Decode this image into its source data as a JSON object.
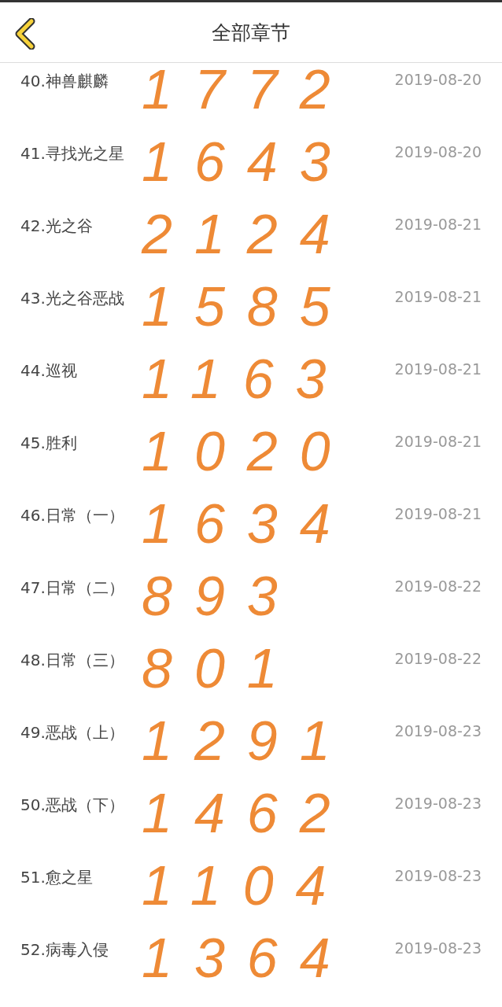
{
  "header": {
    "title": "全部章节"
  },
  "chapters": [
    {
      "title": "40.神兽麒麟",
      "date": "2019-08-20",
      "note": "1772"
    },
    {
      "title": "41.寻找光之星",
      "date": "2019-08-20",
      "note": "1643"
    },
    {
      "title": "42.光之谷",
      "date": "2019-08-21",
      "note": "2124"
    },
    {
      "title": "43.光之谷恶战",
      "date": "2019-08-21",
      "note": "1585"
    },
    {
      "title": "44.巡视",
      "date": "2019-08-21",
      "note": "1163"
    },
    {
      "title": "45.胜利",
      "date": "2019-08-21",
      "note": "1020"
    },
    {
      "title": "46.日常（一）",
      "date": "2019-08-21",
      "note": "1634"
    },
    {
      "title": "47.日常（二）",
      "date": "2019-08-22",
      "note": "893"
    },
    {
      "title": "48.日常（三）",
      "date": "2019-08-22",
      "note": "801"
    },
    {
      "title": "49.恶战（上）",
      "date": "2019-08-23",
      "note": "1291"
    },
    {
      "title": "50.恶战（下）",
      "date": "2019-08-23",
      "note": "1462"
    },
    {
      "title": "51.愈之星",
      "date": "2019-08-23",
      "note": "1104"
    },
    {
      "title": "52.病毒入侵",
      "date": "2019-08-23",
      "note": "1364"
    }
  ]
}
